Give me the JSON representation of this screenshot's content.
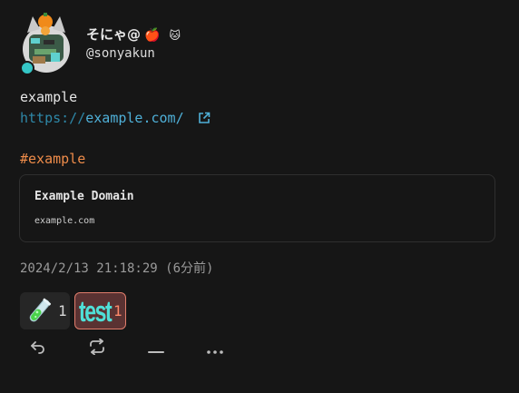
{
  "user": {
    "display_name": "そにゃ@",
    "display_emoji": "🍎",
    "badge_emoji": "🐱",
    "username": "@sonyakun",
    "online_color": "#34c6c6"
  },
  "note": {
    "text": "example",
    "url_scheme": "https://",
    "url_host": "example.com/",
    "hashtag": "#example",
    "timestamp": "2024/2/13 21:18:29 (6分前)"
  },
  "preview": {
    "title": "Example Domain",
    "host": "example.com"
  },
  "reactions": [
    {
      "emoji": "test-tube-icon",
      "count": "1"
    },
    {
      "emoji": "test",
      "count": "1"
    }
  ],
  "actions": [
    "reply-icon",
    "renote-icon",
    "react-icon",
    "more-icon"
  ],
  "colors": {
    "background": "#161616",
    "link": "#4fb0d8",
    "hashtag": "#ef8c4a",
    "reacted_border": "#e07d6c"
  }
}
